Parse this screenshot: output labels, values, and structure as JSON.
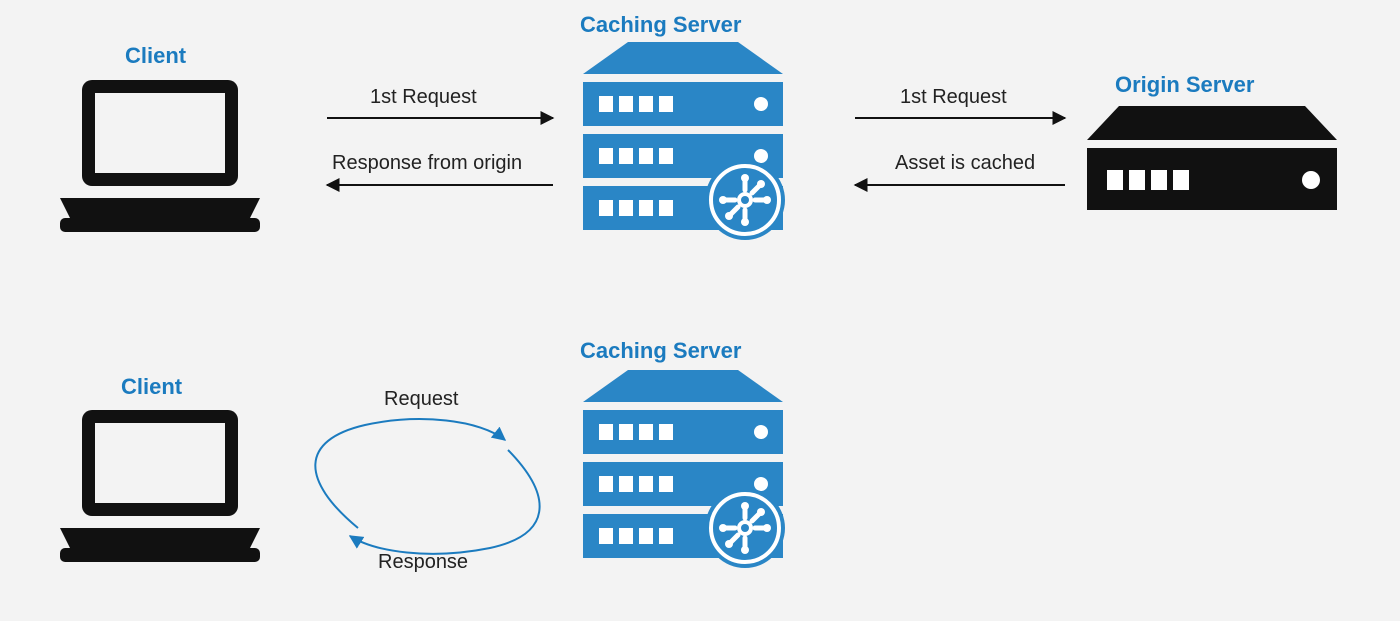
{
  "colors": {
    "accent": "#1b7bbf",
    "accent_dark": "#146a9e",
    "ink": "#111111"
  },
  "titles": {
    "client_top": "Client",
    "caching_top": "Caching Server",
    "origin": "Origin Server",
    "client_bottom": "Client",
    "caching_bottom": "Caching Server"
  },
  "labels": {
    "req1_left": "1st Request",
    "resp1_left": "Response from origin",
    "req1_right": "1st Request",
    "resp1_right": "Asset is cached",
    "req2": "Request",
    "resp2": "Response"
  }
}
